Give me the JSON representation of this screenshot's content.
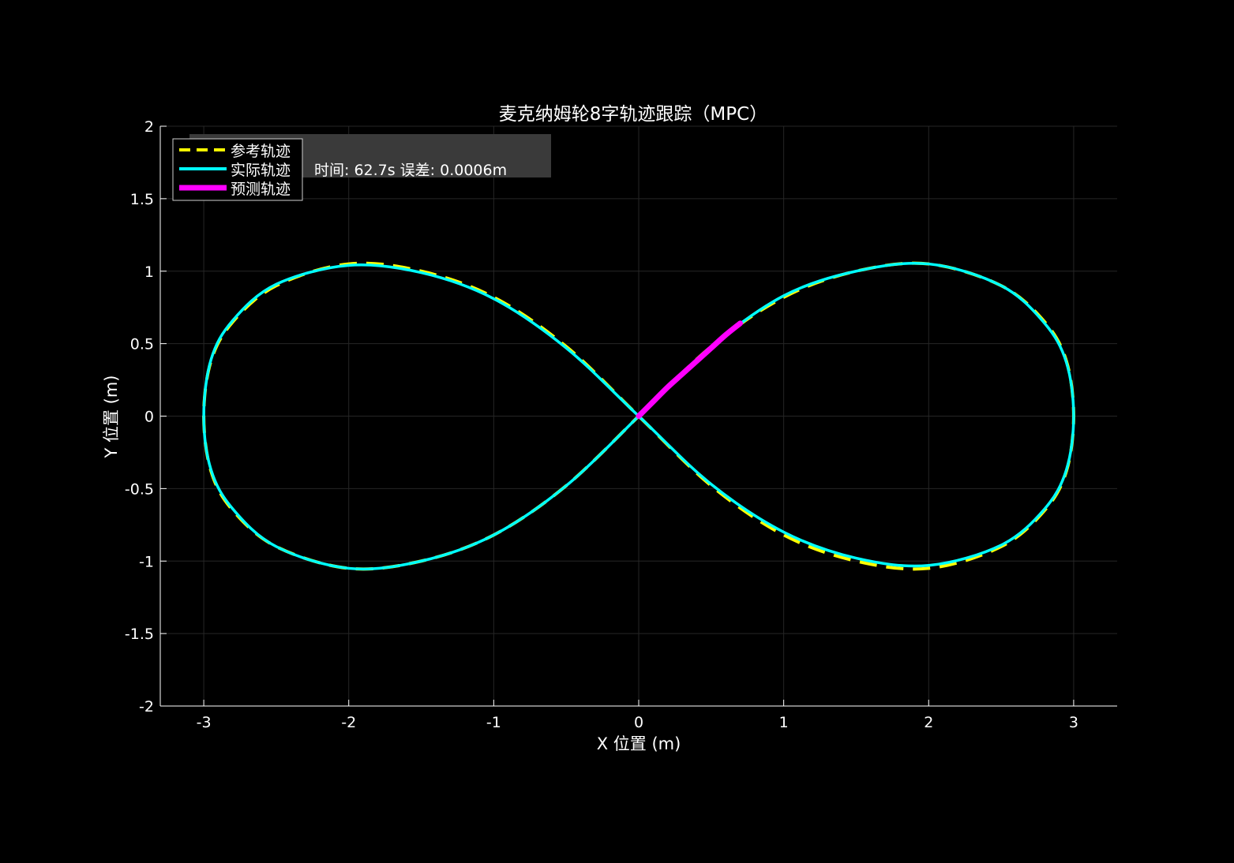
{
  "chart_data": {
    "type": "line",
    "title": "麦克纳姆轮8字轨迹跟踪（MPC）",
    "xlabel": "X 位置 (m)",
    "ylabel": "Y 位置 (m)",
    "xlim": [
      -3.3,
      3.3
    ],
    "ylim": [
      -2,
      2
    ],
    "xticks": [
      -3,
      -2,
      -1,
      0,
      1,
      2,
      3
    ],
    "yticks": [
      -2,
      -1.5,
      -1,
      -0.5,
      0,
      0.5,
      1,
      1.5,
      2
    ],
    "xtick_labels": [
      "-3",
      "-2",
      "-1",
      "0",
      "1",
      "2",
      "3"
    ],
    "ytick_labels": [
      "-2",
      "-1.5",
      "-1",
      "-0.5",
      "0",
      "0.5",
      "1",
      "1.5",
      "2"
    ],
    "grid": true,
    "legend_position": "top-left",
    "annotation": "时间: 62.7s  误差: 0.0006m",
    "series": [
      {
        "name": "参考轨迹",
        "color": "#ffff00",
        "style": "dashed",
        "x": [
          0,
          0.5,
          1.0,
          1.5,
          2.0,
          2.5,
          2.8,
          2.95,
          3.0,
          2.95,
          2.8,
          2.5,
          2.0,
          1.5,
          1.0,
          0.5,
          0,
          -0.5,
          -1.0,
          -1.5,
          -2.0,
          -2.5,
          -2.8,
          -2.95,
          -3.0,
          -2.95,
          -2.8,
          -2.5,
          -2.0,
          -1.5,
          -1.0,
          -0.5,
          0
        ],
        "y": [
          0,
          0.48,
          0.82,
          1.0,
          1.05,
          0.9,
          0.65,
          0.38,
          0,
          -0.38,
          -0.65,
          -0.9,
          -1.05,
          -1.0,
          -0.82,
          -0.48,
          0,
          0.48,
          0.82,
          1.0,
          1.05,
          0.9,
          0.65,
          0.38,
          0,
          -0.38,
          -0.65,
          -0.9,
          -1.05,
          -1.0,
          -0.82,
          -0.48,
          0
        ]
      },
      {
        "name": "实际轨迹",
        "color": "#00ffff",
        "style": "solid",
        "x": [
          0,
          0.5,
          1.0,
          1.5,
          2.0,
          2.5,
          2.8,
          2.95,
          3.0,
          2.95,
          2.8,
          2.5,
          2.0,
          1.5,
          1.0,
          0.5,
          0,
          -0.5,
          -1.0,
          -1.5,
          -2.0,
          -2.5,
          -2.8,
          -2.95,
          -3.0,
          -2.95,
          -2.8,
          -2.5,
          -2.0,
          -1.5,
          -1.0,
          -0.5,
          0
        ],
        "y": [
          0,
          0.48,
          0.83,
          1.0,
          1.05,
          0.9,
          0.64,
          0.37,
          0,
          -0.37,
          -0.64,
          -0.89,
          -1.03,
          -0.98,
          -0.8,
          -0.47,
          0,
          0.47,
          0.81,
          0.99,
          1.04,
          0.91,
          0.66,
          0.39,
          0,
          -0.37,
          -0.64,
          -0.9,
          -1.05,
          -1.0,
          -0.82,
          -0.48,
          0
        ]
      },
      {
        "name": "预测轨迹",
        "color": "#ff00ff",
        "style": "solid-thick",
        "x": [
          0,
          0.1,
          0.2,
          0.3,
          0.4,
          0.5,
          0.6,
          0.7
        ],
        "y": [
          0,
          0.1,
          0.2,
          0.29,
          0.38,
          0.47,
          0.56,
          0.64
        ]
      }
    ]
  }
}
